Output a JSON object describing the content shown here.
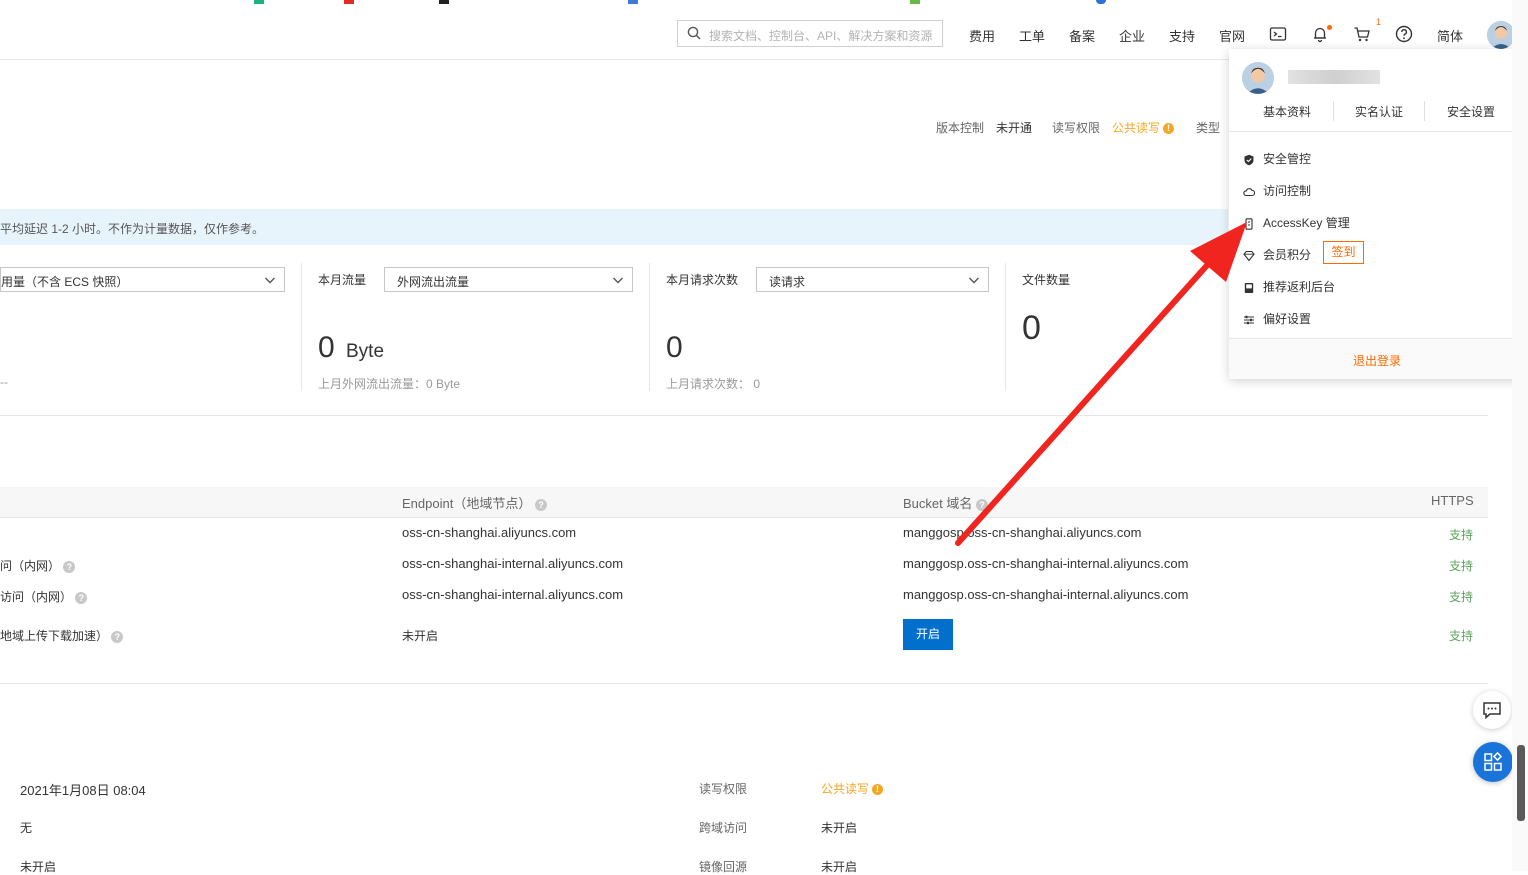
{
  "topbar": {
    "search_placeholder": "搜索文档、控制台、API、解决方案和资源",
    "nav": [
      "费用",
      "工单",
      "备案",
      "企业",
      "支持",
      "官网"
    ],
    "cart_badge": "1",
    "lang": "简体"
  },
  "bucket_meta": {
    "version_label": "版本控制",
    "version_value": "未开通",
    "acl_label": "读写权限",
    "acl_value": "公共读写",
    "type_label": "类型"
  },
  "notice": "平均延迟 1-2 小时。不作为计量数据，仅作参考。",
  "stats": [
    {
      "select": "用量（不含 ECS 快照）",
      "value": "",
      "sub": "--"
    },
    {
      "label": "本月流量",
      "select": "外网流出流量",
      "value": "0",
      "unit": "Byte",
      "sub": "上月外网流出流量：0 Byte"
    },
    {
      "label": "本月请求次数",
      "select": "读请求",
      "value": "0",
      "sub": "上月请求次数：  0"
    },
    {
      "label": "文件数量",
      "value": "0"
    }
  ],
  "endpoint_table": {
    "headers": {
      "endpoint": "Endpoint（地域节点）",
      "domain": "Bucket 域名",
      "https": "HTTPS"
    },
    "rows": [
      {
        "name": "",
        "endpoint": "oss-cn-shanghai.aliyuncs.com",
        "domain": "manggosp.oss-cn-shanghai.aliyuncs.com",
        "https": "支持"
      },
      {
        "name": "问（内网）",
        "endpoint": "oss-cn-shanghai-internal.aliyuncs.com",
        "domain": "manggosp.oss-cn-shanghai-internal.aliyuncs.com",
        "https": "支持"
      },
      {
        "name": "访问（内网）",
        "endpoint": "oss-cn-shanghai-internal.aliyuncs.com",
        "domain": "manggosp.oss-cn-shanghai-internal.aliyuncs.com",
        "https": "支持"
      },
      {
        "name": "地域上传下载加速）",
        "endpoint": "未开启",
        "domain_button": "开启",
        "https": "支持"
      }
    ]
  },
  "info": {
    "created": "2021年1月08日 08:04",
    "left2": "无",
    "left3": "未开启",
    "acl_label": "读写权限",
    "acl_value": "公共读写",
    "cors_label": "跨域访问",
    "cors_value": "未开启",
    "mirror_label": "镜像回源",
    "mirror_value": "未开启"
  },
  "dropdown": {
    "tabs": [
      "基本资料",
      "实名认证",
      "安全设置"
    ],
    "items": [
      "安全管控",
      "访问控制",
      "AccessKey 管理",
      "会员积分",
      "推荐返利后台",
      "偏好设置"
    ],
    "checkin": "签到",
    "logout": "退出登录"
  },
  "colors": {
    "accent": "#ff6a00",
    "primary": "#0070cc",
    "arrow": "#f0251f",
    "support": "#5aa35a",
    "warning": "#f5a623"
  }
}
